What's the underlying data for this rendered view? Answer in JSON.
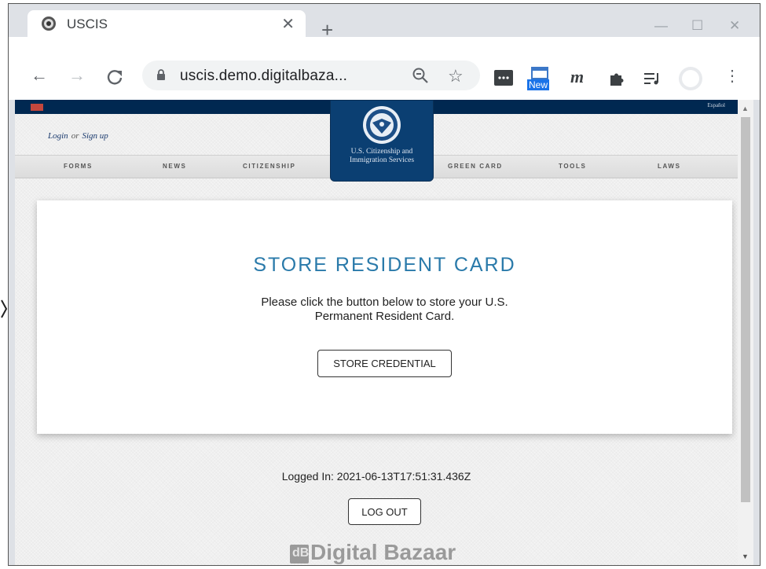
{
  "browser": {
    "tab_title": "USCIS",
    "url": "uscis.demo.digitalbaza...",
    "extension_badge": "New",
    "extension_m": "m"
  },
  "site": {
    "espanol": "Español",
    "login": "Login",
    "or": "or",
    "signup": "Sign up",
    "seal_line1": "U.S. Citizenship and",
    "seal_line2": "Immigration Services",
    "nav": [
      "FORMS",
      "NEWS",
      "CITIZENSHIP",
      "GREEN CARD",
      "TOOLS",
      "LAWS"
    ]
  },
  "card": {
    "title": "STORE RESIDENT CARD",
    "desc_line1": "Please click the button below to store your U.S.",
    "desc_line2": "Permanent Resident Card.",
    "button": "STORE CREDENTIAL"
  },
  "footer": {
    "logged_in": "Logged In: 2021-06-13T17:51:31.436Z",
    "logout": "LOG OUT",
    "brand": "Digital Bazaar",
    "brand_mark": "dB"
  },
  "colors": {
    "band": "#002851",
    "seal_box": "#0b3f72",
    "title": "#2a7aaa"
  }
}
